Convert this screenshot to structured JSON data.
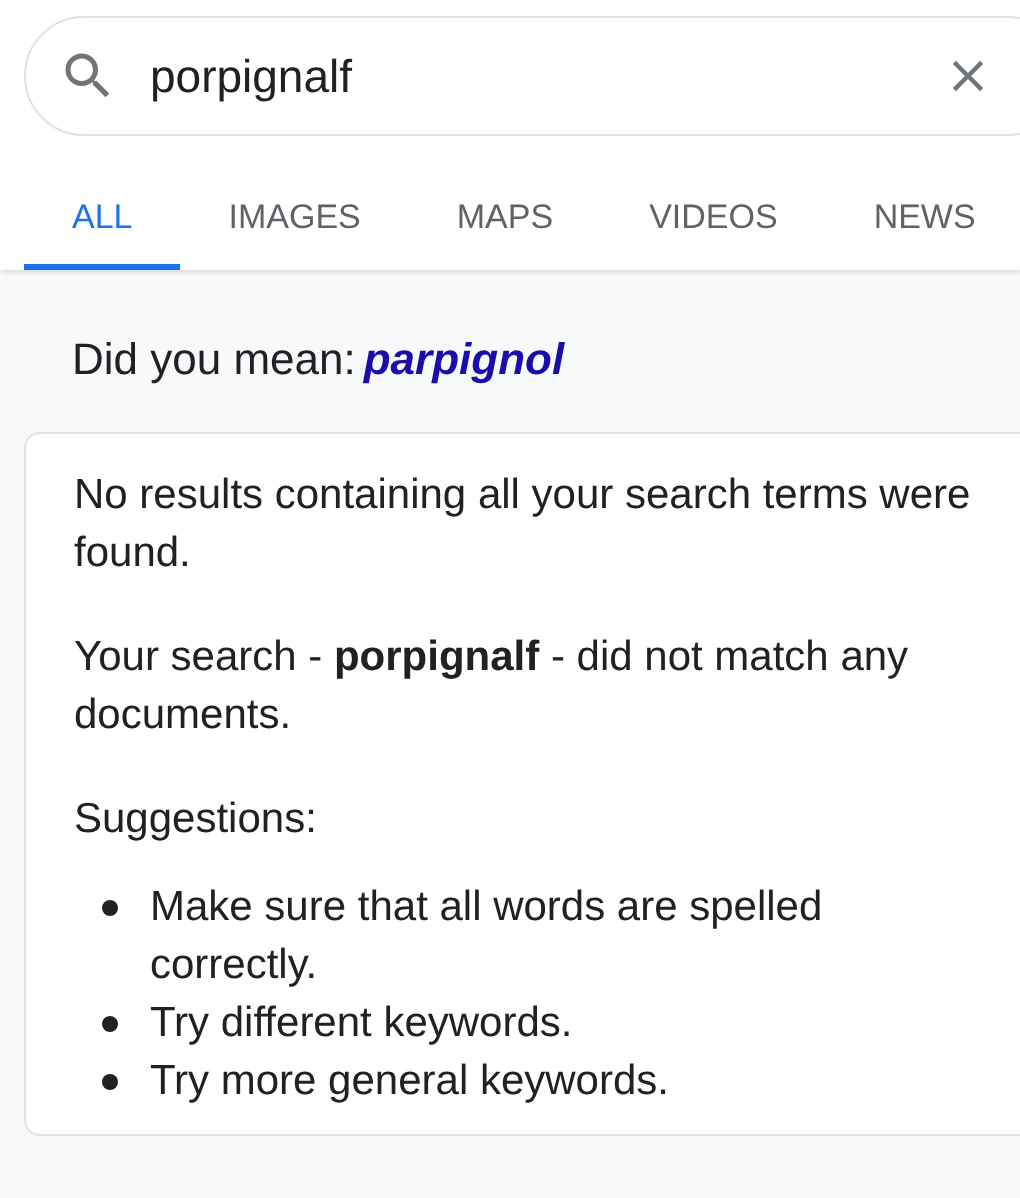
{
  "search": {
    "value": "porpignalf"
  },
  "tabs": [
    {
      "label": "ALL",
      "selected": true
    },
    {
      "label": "IMAGES",
      "selected": false
    },
    {
      "label": "MAPS",
      "selected": false
    },
    {
      "label": "VIDEOS",
      "selected": false
    },
    {
      "label": "NEWS",
      "selected": false
    }
  ],
  "did_you_mean": {
    "label": "Did you mean:",
    "suggestion": "parpignol"
  },
  "card": {
    "paragraphs": [
      "No results containing all your search terms were found.",
      "Your search - **porpignalf** - did not match any documents.",
      "Suggestions:"
    ],
    "bullets": [
      "Make sure that all words are spelled correctly.",
      "Try different keywords.",
      "Try more general keywords."
    ]
  }
}
